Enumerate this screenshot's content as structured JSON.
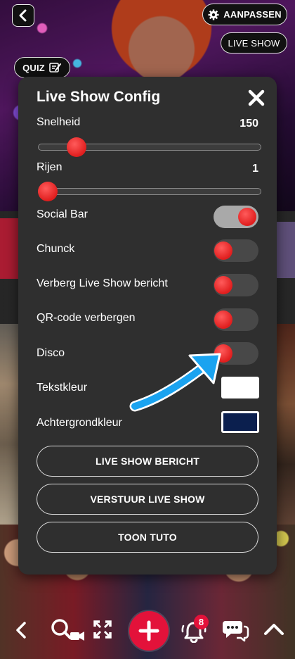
{
  "top": {
    "adjust_label": "AANPASSEN",
    "live_show_label": "LIVE SHOW",
    "quiz_label": "QUIZ"
  },
  "modal": {
    "title": "Live Show Config",
    "speed": {
      "label": "Snelheid",
      "value": "150",
      "level": 0.17
    },
    "rows": {
      "label": "Rijen",
      "value": "1",
      "level": 0.04
    },
    "toggles": [
      {
        "label": "Social Bar",
        "on": true
      },
      {
        "label": "Chunck",
        "on": false
      },
      {
        "label": "Verberg Live Show bericht",
        "on": false
      },
      {
        "label": "QR-code verbergen",
        "on": false
      },
      {
        "label": "Disco",
        "on": false
      }
    ],
    "text_color": {
      "label": "Tekstkleur",
      "color": "#ffffff"
    },
    "background_color": {
      "label": "Achtergrondkleur",
      "color": "#0b1f4e"
    },
    "buttons": {
      "live_show_message": "LIVE SHOW BERICHT",
      "send_live_show": "VERSTUUR LIVE SHOW",
      "show_tutorial": "TOON TUTO"
    }
  },
  "bottom_bar": {
    "notification_count": "8",
    "icons": [
      "chevron-left-icon",
      "search-video-icon",
      "fullscreen-icon",
      "plus-icon",
      "bell-icon",
      "chat-icon",
      "chevron-up-icon"
    ]
  },
  "colors": {
    "accent_red": "#e01e1e",
    "brand_red": "#e3123a",
    "modal_bg": "#2f2f2f",
    "arrow_blue": "#1aa3f0"
  }
}
